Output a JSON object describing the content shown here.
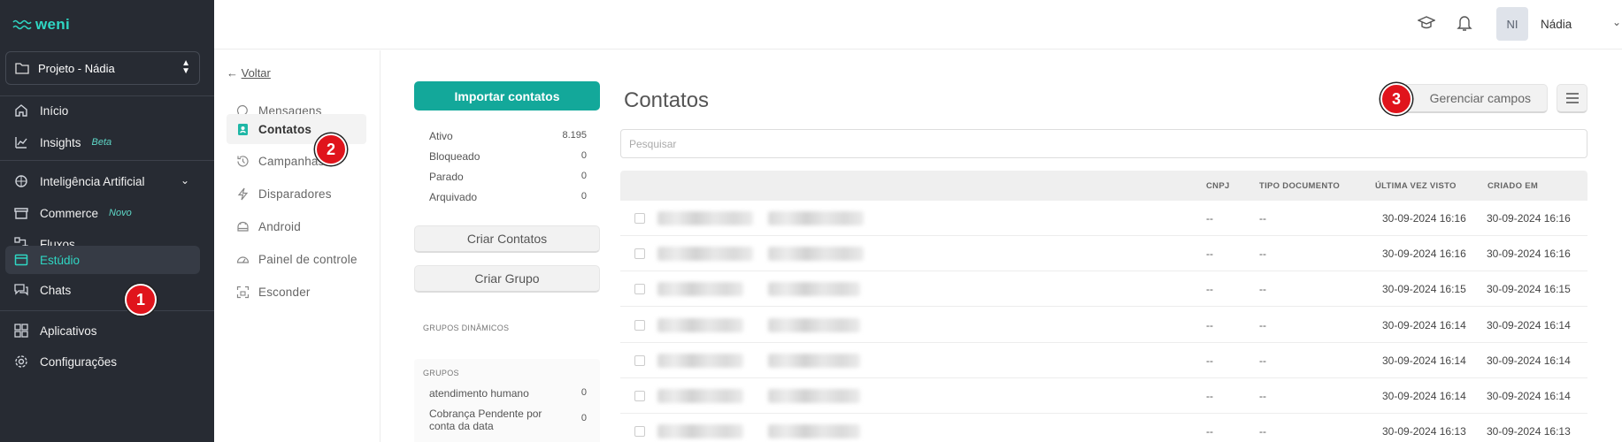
{
  "brand": {
    "logo_text": "weni"
  },
  "project": {
    "label": "Projeto - Nádia"
  },
  "sidebar": {
    "items": [
      {
        "label": "Início",
        "icon": "home-icon"
      },
      {
        "label": "Insights",
        "tag": "Beta",
        "icon": "chart-icon"
      },
      {
        "label": "Inteligência Artificial",
        "icon": "brain-icon"
      },
      {
        "label": "Commerce",
        "tag": "Novo",
        "icon": "store-icon"
      },
      {
        "label": "Fluxos",
        "icon": "flow-icon"
      },
      {
        "label": "Estúdio",
        "icon": "studio-icon",
        "active": true
      },
      {
        "label": "Chats",
        "icon": "chats-icon"
      },
      {
        "label": "Aplicativos",
        "icon": "apps-icon"
      },
      {
        "label": "Configurações",
        "icon": "gear-icon"
      }
    ]
  },
  "user": {
    "initials": "NI",
    "name": "Nádia"
  },
  "studio_nav": {
    "back_arrow": "←",
    "back_label": "Voltar",
    "items": [
      {
        "label": "Mensagens",
        "icon": "message-icon"
      },
      {
        "label": "Contatos",
        "icon": "contact-icon",
        "active": true
      },
      {
        "label": "Campanhas",
        "icon": "campaign-icon"
      },
      {
        "label": "Disparadores",
        "icon": "trigger-icon"
      },
      {
        "label": "Android",
        "icon": "android-icon"
      },
      {
        "label": "Painel de controle",
        "icon": "dashboard-icon"
      },
      {
        "label": "Esconder",
        "icon": "hide-icon"
      }
    ]
  },
  "panel": {
    "import_button": "Importar contatos",
    "stats": [
      {
        "label": "Ativo",
        "value": "8.195"
      },
      {
        "label": "Bloqueado",
        "value": "0"
      },
      {
        "label": "Parado",
        "value": "0"
      },
      {
        "label": "Arquivado",
        "value": "0"
      }
    ],
    "create_contacts_button": "Criar Contatos",
    "create_group_button": "Criar Grupo",
    "dynamic_groups_title": "GRUPOS DINÂMICOS",
    "groups_title": "GRUPOS",
    "groups": [
      {
        "label": "atendimento humano",
        "value": "0"
      },
      {
        "label": "Cobrança Pendente por conta da data",
        "value": "0"
      }
    ]
  },
  "main": {
    "title": "Contatos",
    "manage_fields_button": "Gerenciar campos",
    "search_placeholder": "Pesquisar",
    "columns": [
      "CNPJ",
      "TIPO DOCUMENTO",
      "ÚLTIMA VEZ VISTO",
      "CRIADO EM"
    ],
    "rows": [
      {
        "cnpj": "--",
        "tipo": "--",
        "visto": "30-09-2024 16:16",
        "criado": "30-09-2024 16:16"
      },
      {
        "cnpj": "--",
        "tipo": "--",
        "visto": "30-09-2024 16:16",
        "criado": "30-09-2024 16:16"
      },
      {
        "cnpj": "--",
        "tipo": "--",
        "visto": "30-09-2024 16:15",
        "criado": "30-09-2024 16:15"
      },
      {
        "cnpj": "--",
        "tipo": "--",
        "visto": "30-09-2024 16:14",
        "criado": "30-09-2024 16:14"
      },
      {
        "cnpj": "--",
        "tipo": "--",
        "visto": "30-09-2024 16:14",
        "criado": "30-09-2024 16:14"
      },
      {
        "cnpj": "--",
        "tipo": "--",
        "visto": "30-09-2024 16:14",
        "criado": "30-09-2024 16:14"
      },
      {
        "cnpj": "--",
        "tipo": "--",
        "visto": "30-09-2024 16:13",
        "criado": "30-09-2024 16:13"
      }
    ]
  },
  "annotations": [
    "1",
    "2",
    "3"
  ],
  "colors": {
    "accent": "#13a89a",
    "sidebar_bg": "#272b33",
    "badge": "#e0141c"
  }
}
